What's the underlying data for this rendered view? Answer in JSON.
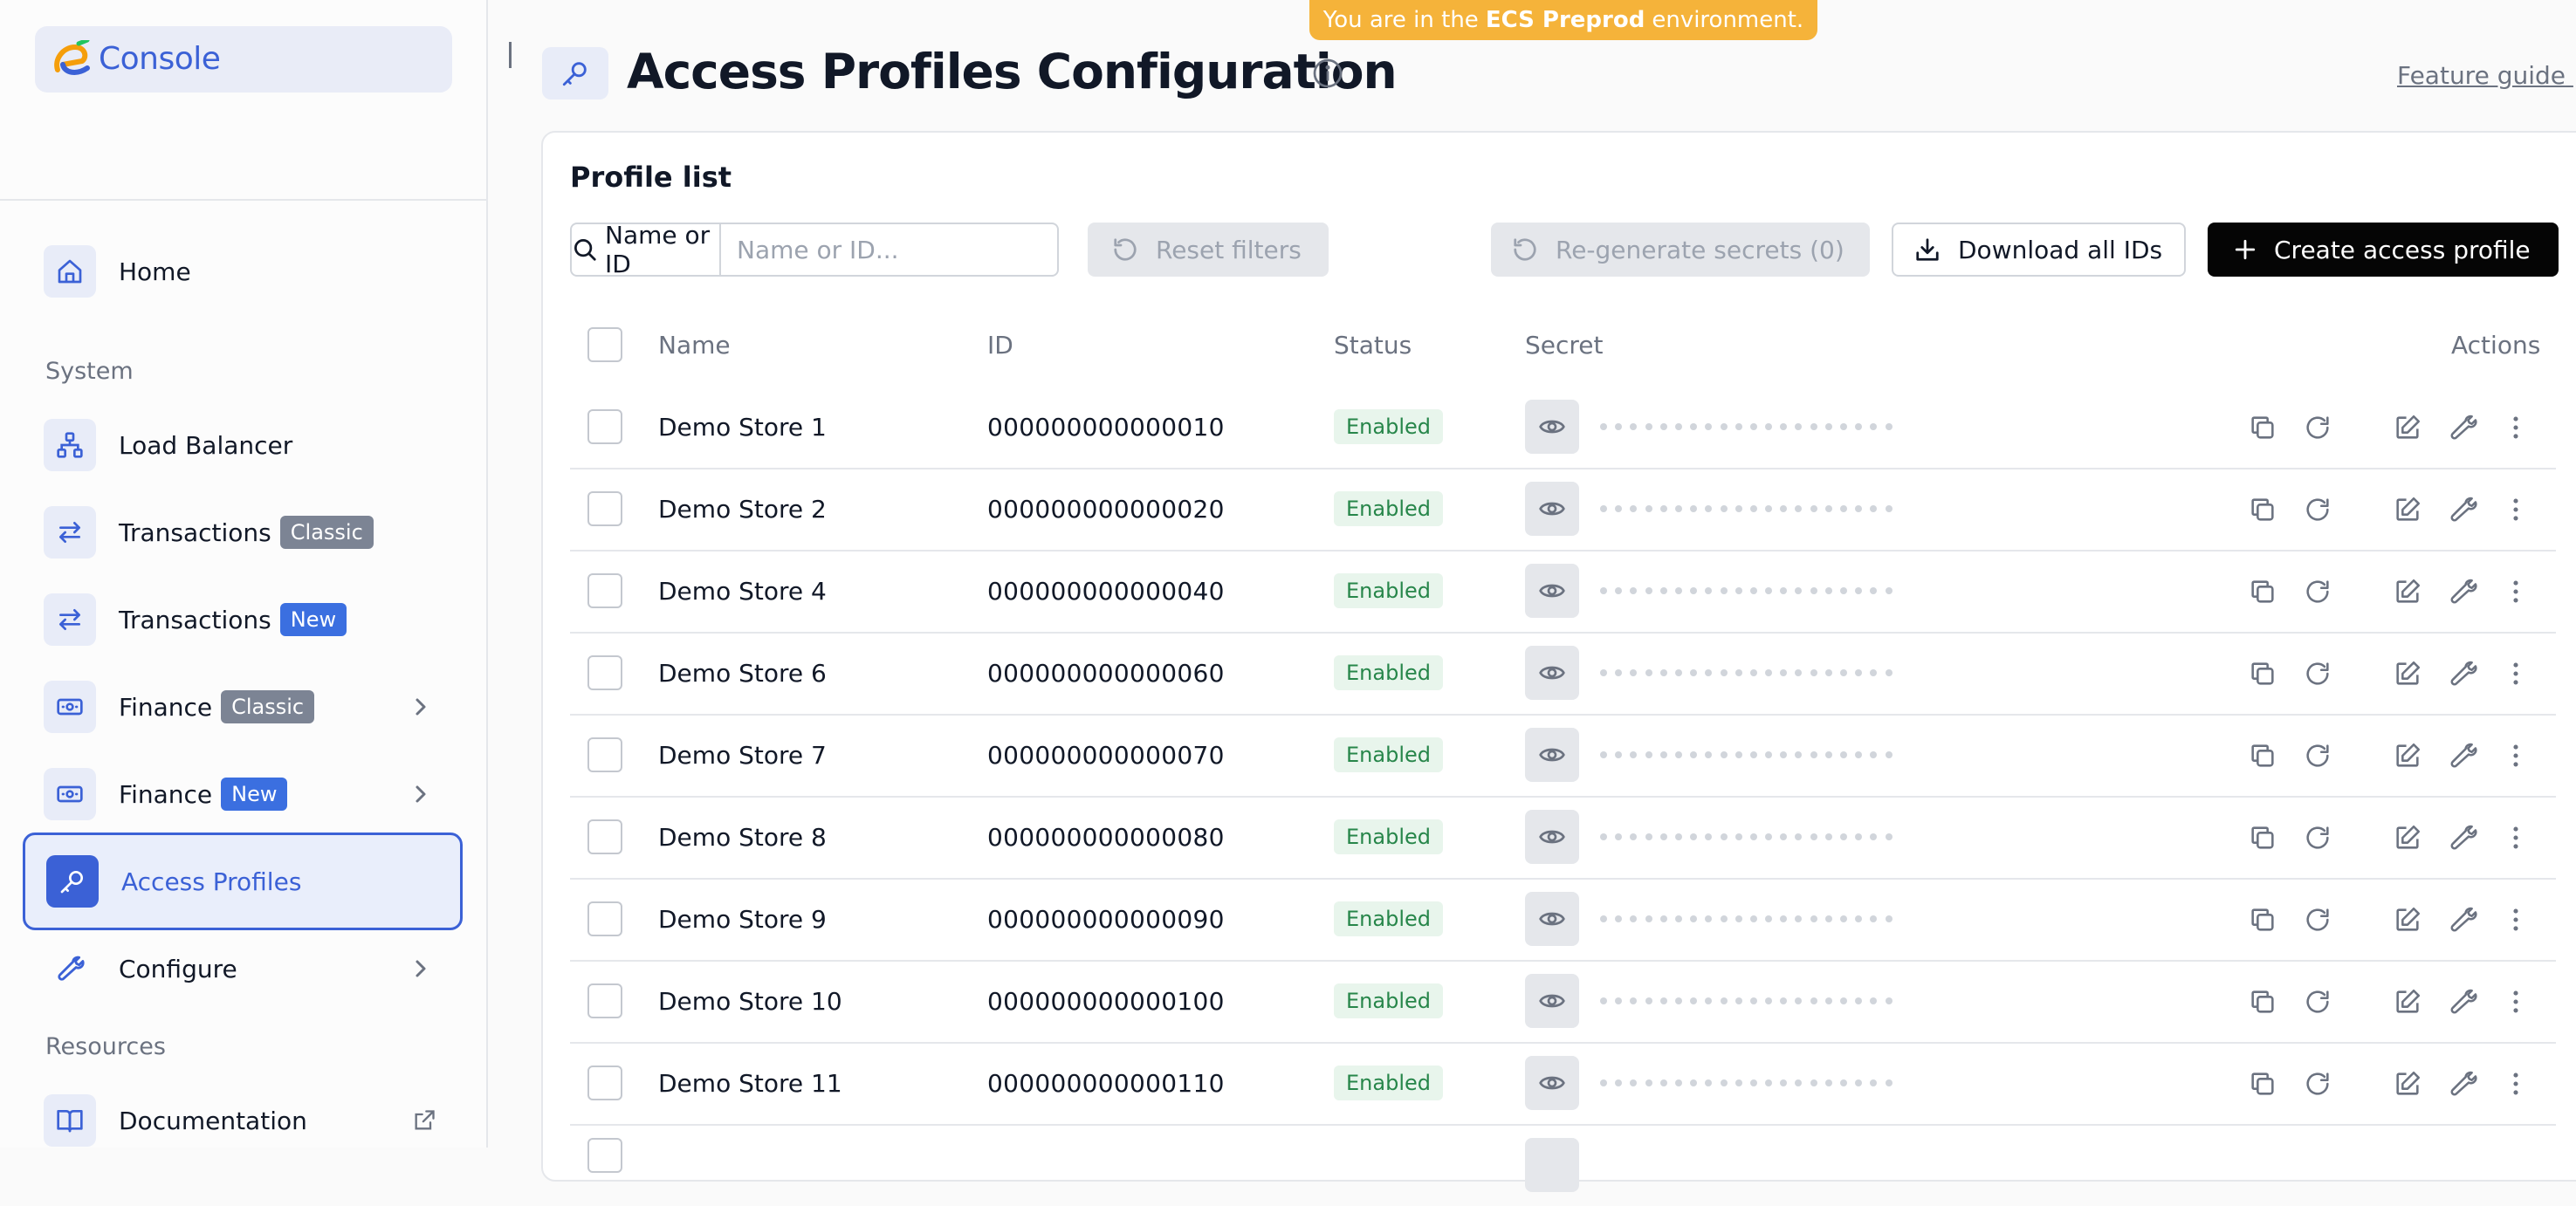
{
  "env_banner": {
    "prefix": "You are in the",
    "env": "ECS Preprod",
    "suffix": "environment."
  },
  "brand": {
    "name": "Console"
  },
  "nav": {
    "home": "Home",
    "system_label": "System",
    "load_balancer": "Load Balancer",
    "transactions_classic": "Transactions",
    "transactions_new": "Transactions",
    "finance_classic": "Finance",
    "finance_new": "Finance",
    "access_profiles": "Access Profiles",
    "configure": "Configure",
    "resources_label": "Resources",
    "documentation": "Documentation",
    "badge_classic": "Classic",
    "badge_new": "New"
  },
  "header": {
    "title": "Access Profiles Configuration",
    "feature_guide": "Feature guide"
  },
  "panel": {
    "title": "Profile list"
  },
  "toolbar": {
    "search_label": "Name or ID",
    "search_placeholder": "Name or ID...",
    "search_value": "",
    "reset_filters": "Reset filters",
    "regenerate": "Re-generate secrets (0)",
    "download": "Download all IDs",
    "create": "Create access profile"
  },
  "table": {
    "columns": {
      "name": "Name",
      "id": "ID",
      "status": "Status",
      "secret": "Secret",
      "actions": "Actions"
    },
    "rows": [
      {
        "name": "Demo Store 1",
        "id": "000000000000010",
        "status": "Enabled"
      },
      {
        "name": "Demo Store 2",
        "id": "000000000000020",
        "status": "Enabled"
      },
      {
        "name": "Demo Store 4",
        "id": "000000000000040",
        "status": "Enabled"
      },
      {
        "name": "Demo Store 6",
        "id": "000000000000060",
        "status": "Enabled"
      },
      {
        "name": "Demo Store 7",
        "id": "000000000000070",
        "status": "Enabled"
      },
      {
        "name": "Demo Store 8",
        "id": "000000000000080",
        "status": "Enabled"
      },
      {
        "name": "Demo Store 9",
        "id": "000000000000090",
        "status": "Enabled"
      },
      {
        "name": "Demo Store 10",
        "id": "000000000000100",
        "status": "Enabled"
      },
      {
        "name": "Demo Store 11",
        "id": "000000000000110",
        "status": "Enabled"
      }
    ]
  },
  "colors": {
    "accent": "#3b61d6",
    "primary_button": "#050505",
    "banner": "#f5b33a",
    "status_text": "#27864a"
  }
}
